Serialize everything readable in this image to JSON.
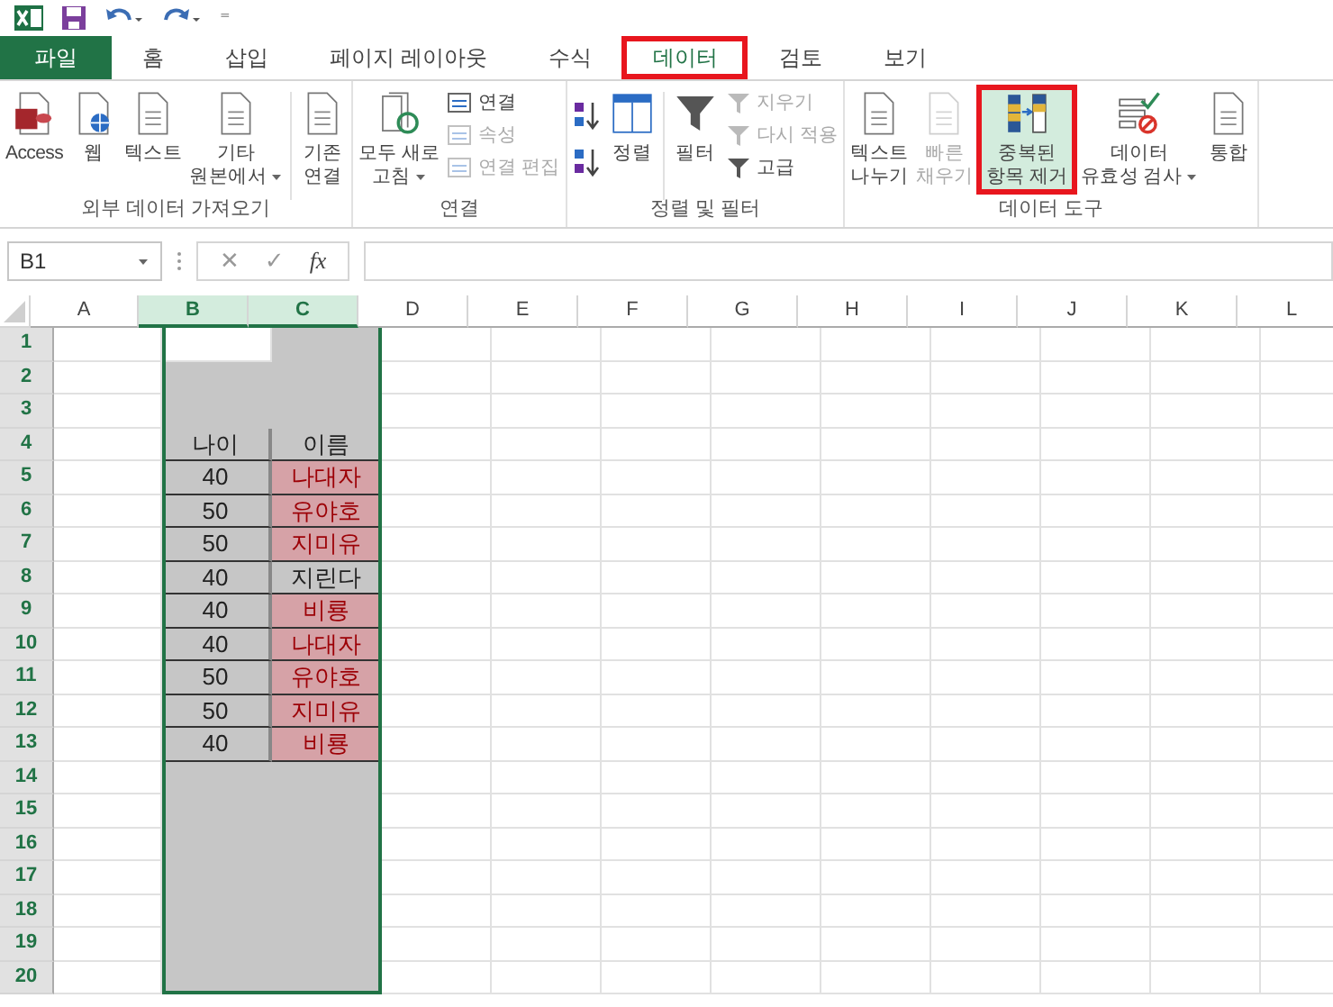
{
  "quick_access": {
    "customize": "⁼"
  },
  "tabs": [
    {
      "label": "파일",
      "kind": "file",
      "selected": false,
      "annotated": false
    },
    {
      "label": "홈",
      "kind": "tab",
      "selected": false,
      "annotated": false
    },
    {
      "label": "삽입",
      "kind": "tab",
      "selected": false,
      "annotated": false
    },
    {
      "label": "페이지 레이아웃",
      "kind": "tab",
      "selected": false,
      "annotated": false
    },
    {
      "label": "수식",
      "kind": "tab",
      "selected": false,
      "annotated": false
    },
    {
      "label": "데이터",
      "kind": "tab",
      "selected": true,
      "annotated": true
    },
    {
      "label": "검토",
      "kind": "tab",
      "selected": false,
      "annotated": false
    },
    {
      "label": "보기",
      "kind": "tab",
      "selected": false,
      "annotated": false
    }
  ],
  "ribbon": {
    "groups": [
      {
        "label": "외부 데이터 가져오기",
        "buttons": [
          {
            "kind": "large",
            "lines": [
              "Access"
            ],
            "disabled": false,
            "dropdown": false,
            "highlighted": false,
            "annotated": false
          },
          {
            "kind": "large",
            "lines": [
              "웹"
            ],
            "disabled": false,
            "dropdown": false,
            "highlighted": false,
            "annotated": false
          },
          {
            "kind": "large",
            "lines": [
              "텍스트"
            ],
            "disabled": false,
            "dropdown": false,
            "highlighted": false,
            "annotated": false
          },
          {
            "kind": "large",
            "lines": [
              "기타",
              "원본에서"
            ],
            "disabled": false,
            "dropdown": true,
            "highlighted": false,
            "annotated": false
          },
          {
            "kind": "separator"
          },
          {
            "kind": "large",
            "lines": [
              "기존",
              "연결"
            ],
            "disabled": false,
            "dropdown": false,
            "highlighted": false,
            "annotated": false
          }
        ]
      },
      {
        "label": "연결",
        "buttons": [
          {
            "kind": "large",
            "lines": [
              "모두 새로",
              "고침"
            ],
            "disabled": false,
            "dropdown": true,
            "highlighted": false,
            "annotated": false
          },
          {
            "kind": "stack",
            "items": [
              {
                "label": "연결",
                "disabled": false
              },
              {
                "label": "속성",
                "disabled": true
              },
              {
                "label": "연결 편집",
                "disabled": true
              }
            ]
          }
        ]
      },
      {
        "label": "정렬 및 필터",
        "buttons": [
          {
            "kind": "sort"
          },
          {
            "kind": "large",
            "lines": [
              "정렬"
            ],
            "disabled": false,
            "dropdown": false,
            "highlighted": false,
            "annotated": false
          },
          {
            "kind": "separator"
          },
          {
            "kind": "large",
            "lines": [
              "필터"
            ],
            "disabled": false,
            "dropdown": false,
            "highlighted": false,
            "annotated": false
          },
          {
            "kind": "stack",
            "items": [
              {
                "label": "지우기",
                "disabled": true
              },
              {
                "label": "다시 적용",
                "disabled": true
              },
              {
                "label": "고급",
                "disabled": false
              }
            ]
          }
        ]
      },
      {
        "label": "데이터 도구",
        "buttons": [
          {
            "kind": "large",
            "lines": [
              "텍스트",
              "나누기"
            ],
            "disabled": false,
            "dropdown": false,
            "highlighted": false,
            "annotated": false
          },
          {
            "kind": "large",
            "lines": [
              "빠른",
              "채우기"
            ],
            "disabled": true,
            "dropdown": false,
            "highlighted": false,
            "annotated": false
          },
          {
            "kind": "large",
            "lines": [
              "중복된",
              "항목 제거"
            ],
            "disabled": false,
            "dropdown": false,
            "highlighted": true,
            "annotated": true
          },
          {
            "kind": "large",
            "lines": [
              "데이터",
              "유효성 검사"
            ],
            "disabled": false,
            "dropdown": true,
            "highlighted": false,
            "annotated": false
          },
          {
            "kind": "large",
            "lines": [
              "통합"
            ],
            "disabled": false,
            "dropdown": false,
            "highlighted": false,
            "annotated": false
          }
        ]
      }
    ]
  },
  "formula_bar": {
    "name_box": "B1",
    "cancel": "✕",
    "enter": "✓",
    "function": "fx"
  },
  "sheet": {
    "columns": [
      {
        "label": "A",
        "selected": false
      },
      {
        "label": "B",
        "selected": true
      },
      {
        "label": "C",
        "selected": true
      },
      {
        "label": "D",
        "selected": false
      },
      {
        "label": "E",
        "selected": false
      },
      {
        "label": "F",
        "selected": false
      },
      {
        "label": "G",
        "selected": false
      },
      {
        "label": "H",
        "selected": false
      },
      {
        "label": "I",
        "selected": false
      },
      {
        "label": "J",
        "selected": false
      },
      {
        "label": "K",
        "selected": false
      },
      {
        "label": "L",
        "selected": false
      }
    ],
    "rows": [
      {
        "label": "1",
        "selected": true,
        "cells": [
          {
            "shaded": false,
            "bordered": false,
            "duplicate": false
          },
          {
            "shaded": true,
            "bordered": false,
            "duplicate": false
          }
        ]
      },
      {
        "label": "2",
        "selected": true,
        "cells": [
          {
            "shaded": true,
            "bordered": false,
            "duplicate": false
          },
          {
            "shaded": true,
            "bordered": false,
            "duplicate": false
          }
        ]
      },
      {
        "label": "3",
        "selected": true,
        "cells": [
          {
            "shaded": true,
            "bordered": false,
            "duplicate": false
          },
          {
            "shaded": true,
            "bordered": false,
            "duplicate": false
          }
        ]
      },
      {
        "label": "4",
        "selected": true,
        "cells": [
          {
            "value": "나이",
            "shaded": true,
            "bordered": true,
            "duplicate": false
          },
          {
            "value": "이름",
            "shaded": true,
            "bordered": true,
            "duplicate": false
          }
        ]
      },
      {
        "label": "5",
        "selected": true,
        "cells": [
          {
            "value": "40",
            "shaded": true,
            "bordered": true,
            "duplicate": false
          },
          {
            "value": "나대자",
            "shaded": true,
            "bordered": true,
            "duplicate": true
          }
        ]
      },
      {
        "label": "6",
        "selected": true,
        "cells": [
          {
            "value": "50",
            "shaded": true,
            "bordered": true,
            "duplicate": false
          },
          {
            "value": "유야호",
            "shaded": true,
            "bordered": true,
            "duplicate": true
          }
        ]
      },
      {
        "label": "7",
        "selected": true,
        "cells": [
          {
            "value": "50",
            "shaded": true,
            "bordered": true,
            "duplicate": false
          },
          {
            "value": "지미유",
            "shaded": true,
            "bordered": true,
            "duplicate": true
          }
        ]
      },
      {
        "label": "8",
        "selected": true,
        "cells": [
          {
            "value": "40",
            "shaded": true,
            "bordered": true,
            "duplicate": false
          },
          {
            "value": "지린다",
            "shaded": true,
            "bordered": true,
            "duplicate": false
          }
        ]
      },
      {
        "label": "9",
        "selected": true,
        "cells": [
          {
            "value": "40",
            "shaded": true,
            "bordered": true,
            "duplicate": false
          },
          {
            "value": "비룡",
            "shaded": true,
            "bordered": true,
            "duplicate": true
          }
        ]
      },
      {
        "label": "10",
        "selected": true,
        "cells": [
          {
            "value": "40",
            "shaded": true,
            "bordered": true,
            "duplicate": false
          },
          {
            "value": "나대자",
            "shaded": true,
            "bordered": true,
            "duplicate": true
          }
        ]
      },
      {
        "label": "11",
        "selected": true,
        "cells": [
          {
            "value": "50",
            "shaded": true,
            "bordered": true,
            "duplicate": false
          },
          {
            "value": "유야호",
            "shaded": true,
            "bordered": true,
            "duplicate": true
          }
        ]
      },
      {
        "label": "12",
        "selected": true,
        "cells": [
          {
            "value": "50",
            "shaded": true,
            "bordered": true,
            "duplicate": false
          },
          {
            "value": "지미유",
            "shaded": true,
            "bordered": true,
            "duplicate": true
          }
        ]
      },
      {
        "label": "13",
        "selected": true,
        "cells": [
          {
            "value": "40",
            "shaded": true,
            "bordered": true,
            "duplicate": false
          },
          {
            "value": "비룡",
            "shaded": true,
            "bordered": true,
            "duplicate": true
          }
        ]
      },
      {
        "label": "14",
        "selected": true,
        "cells": [
          {
            "shaded": true,
            "bordered": false,
            "duplicate": false
          },
          {
            "shaded": true,
            "bordered": false,
            "duplicate": false
          }
        ]
      },
      {
        "label": "15",
        "selected": true,
        "cells": [
          {
            "shaded": true,
            "bordered": false,
            "duplicate": false
          },
          {
            "shaded": true,
            "bordered": false,
            "duplicate": false
          }
        ]
      },
      {
        "label": "16",
        "selected": true,
        "cells": [
          {
            "shaded": true,
            "bordered": false,
            "duplicate": false
          },
          {
            "shaded": true,
            "bordered": false,
            "duplicate": false
          }
        ]
      },
      {
        "label": "17",
        "selected": true,
        "cells": [
          {
            "shaded": true,
            "bordered": false,
            "duplicate": false
          },
          {
            "shaded": true,
            "bordered": false,
            "duplicate": false
          }
        ]
      },
      {
        "label": "18",
        "selected": true,
        "cells": [
          {
            "shaded": true,
            "bordered": false,
            "duplicate": false
          },
          {
            "shaded": true,
            "bordered": false,
            "duplicate": false
          }
        ]
      },
      {
        "label": "19",
        "selected": true,
        "cells": [
          {
            "shaded": true,
            "bordered": false,
            "duplicate": false
          },
          {
            "shaded": true,
            "bordered": false,
            "duplicate": false
          }
        ]
      },
      {
        "label": "20",
        "selected": true,
        "cells": [
          {
            "shaded": true,
            "bordered": false,
            "duplicate": false
          },
          {
            "shaded": true,
            "bordered": false,
            "duplicate": false
          }
        ]
      }
    ]
  }
}
